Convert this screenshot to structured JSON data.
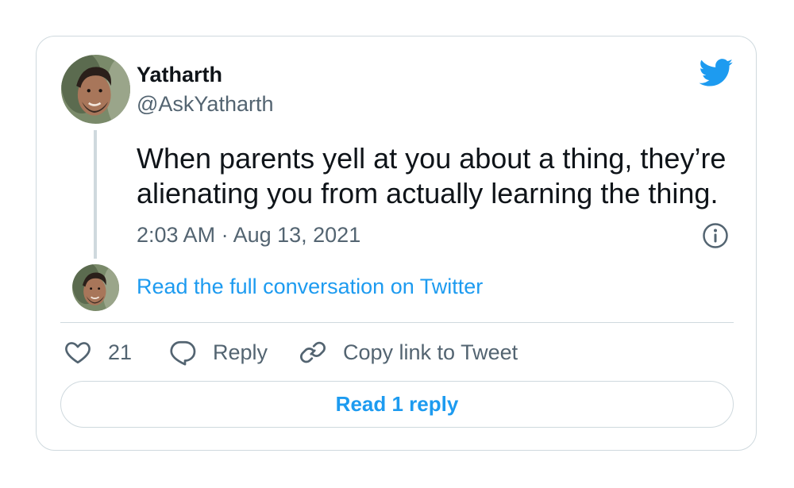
{
  "tweet": {
    "author_name": "Yatharth",
    "author_handle": "@AskYatharth",
    "text": "When parents yell at you about a thing, they’re alienating you from actually learning the thing.",
    "timestamp": "2:03 AM · Aug 13, 2021",
    "full_conversation_link": "Read the full conversation on Twitter"
  },
  "actions": {
    "like_count": "21",
    "reply_label": "Reply",
    "copy_link_label": "Copy link to Tweet"
  },
  "read_reply_button": "Read 1 reply",
  "icons": {
    "brand": "twitter-bird-icon",
    "info": "info-icon",
    "like": "heart-icon",
    "reply": "speech-bubble-icon",
    "copy": "link-icon"
  },
  "colors": {
    "accent": "#1d9bf0",
    "text_primary": "#0f1419",
    "text_secondary": "#536471",
    "border": "#cfd9de"
  }
}
